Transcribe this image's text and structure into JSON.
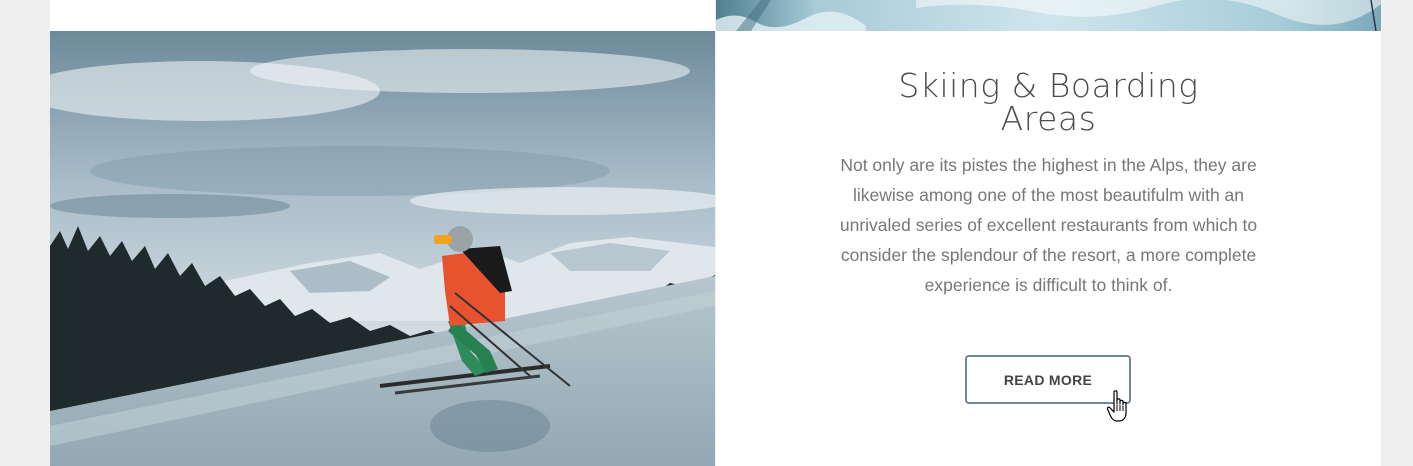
{
  "section": {
    "title_line1": "Skiing & Boarding",
    "title_line2": "Areas",
    "description": "Not only are its pistes the highest in the Alps, they are likewise among one of the most beautifulm with an unrivaled series of excellent restaurants from which to consider the splendour of the resort, a more complete experience is difficult to think of.",
    "button_label": "READ MORE"
  },
  "colors": {
    "page_background": "#efefef",
    "card_background": "#ffffff",
    "button_border": "#6f8694",
    "text_muted": "#777777"
  }
}
